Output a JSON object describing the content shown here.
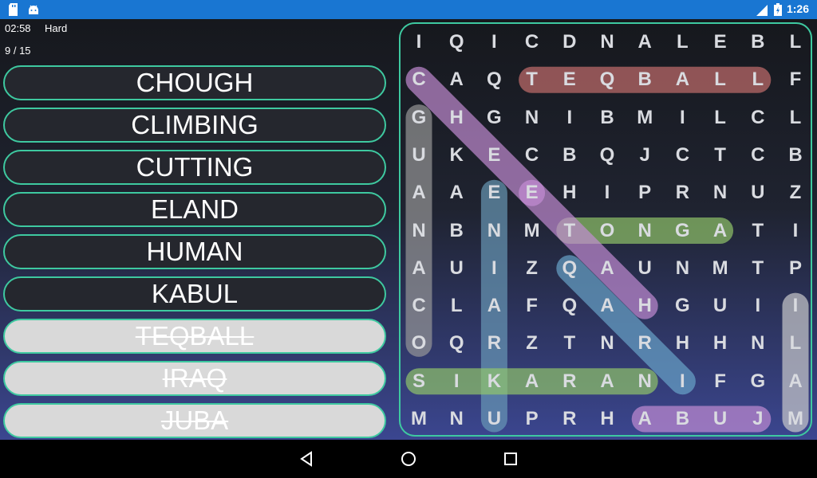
{
  "status_bar": {
    "time": "1:26",
    "icons": [
      "sd-card-icon",
      "android-icon",
      "lte-signal-icon",
      "battery-charging-icon"
    ]
  },
  "hud": {
    "timer": "02:58",
    "difficulty": "Hard",
    "progress": "9 / 15"
  },
  "words": [
    {
      "label": "CHOUGH",
      "found": false
    },
    {
      "label": "CLIMBING",
      "found": false
    },
    {
      "label": "CUTTING",
      "found": false
    },
    {
      "label": "ELAND",
      "found": false
    },
    {
      "label": "HUMAN",
      "found": false
    },
    {
      "label": "KABUL",
      "found": false
    },
    {
      "label": "TEQBALL",
      "found": true
    },
    {
      "label": "IRAQ",
      "found": true
    },
    {
      "label": "JUBA",
      "found": true
    }
  ],
  "grid": [
    [
      "I",
      "Q",
      "I",
      "C",
      "D",
      "N",
      "A",
      "L",
      "E",
      "B",
      "L"
    ],
    [
      "C",
      "A",
      "Q",
      "T",
      "E",
      "Q",
      "B",
      "A",
      "L",
      "L",
      "F"
    ],
    [
      "G",
      "H",
      "G",
      "N",
      "I",
      "B",
      "M",
      "I",
      "L",
      "C",
      "L"
    ],
    [
      "U",
      "K",
      "E",
      "C",
      "B",
      "Q",
      "J",
      "C",
      "T",
      "C",
      "B"
    ],
    [
      "A",
      "A",
      "E",
      "E",
      "H",
      "I",
      "P",
      "R",
      "N",
      "U",
      "Z"
    ],
    [
      "N",
      "B",
      "N",
      "M",
      "T",
      "O",
      "N",
      "G",
      "A",
      "T",
      "I"
    ],
    [
      "A",
      "U",
      "I",
      "Z",
      "Q",
      "A",
      "U",
      "N",
      "M",
      "T",
      "P"
    ],
    [
      "C",
      "L",
      "A",
      "F",
      "Q",
      "A",
      "H",
      "G",
      "U",
      "I",
      "I"
    ],
    [
      "O",
      "Q",
      "R",
      "Z",
      "T",
      "N",
      "R",
      "H",
      "H",
      "N",
      "L"
    ],
    [
      "S",
      "I",
      "K",
      "A",
      "R",
      "A",
      "N",
      "I",
      "F",
      "G",
      "A"
    ],
    [
      "M",
      "N",
      "U",
      "P",
      "R",
      "H",
      "A",
      "B",
      "U",
      "J",
      "M"
    ]
  ],
  "highlights": [
    {
      "word": "TEQBALL",
      "from": [
        1,
        3
      ],
      "to": [
        1,
        9
      ],
      "color": "#c9706f"
    },
    {
      "word": "CHEE",
      "from": [
        1,
        0
      ],
      "to": [
        4,
        3
      ],
      "color": "#c58ed6"
    },
    {
      "word": "GUANACO",
      "from": [
        2,
        0
      ],
      "to": [
        8,
        0
      ],
      "color": "#9a9a9a"
    },
    {
      "word": "EENIAR",
      "from": [
        4,
        2
      ],
      "to": [
        10,
        2
      ],
      "color": "#6a9bb8"
    },
    {
      "word": "TONGA",
      "from": [
        5,
        4
      ],
      "to": [
        5,
        8
      ],
      "color": "#93c86a"
    },
    {
      "word": "AQAH",
      "from": [
        4,
        3
      ],
      "to": [
        7,
        6
      ],
      "color": "#c58ed6"
    },
    {
      "word": "QARNI",
      "from": [
        6,
        4
      ],
      "to": [
        9,
        7
      ],
      "color": "#6aa7cc"
    },
    {
      "word": "SIKARANI",
      "from": [
        9,
        0
      ],
      "to": [
        9,
        6
      ],
      "color": "#93c86a"
    },
    {
      "word": "ILAM",
      "from": [
        7,
        10
      ],
      "to": [
        10,
        10
      ],
      "color": "#cfcfcf"
    },
    {
      "word": "ABUJ",
      "from": [
        10,
        6
      ],
      "to": [
        10,
        9
      ],
      "color": "#c58ed6"
    }
  ]
}
